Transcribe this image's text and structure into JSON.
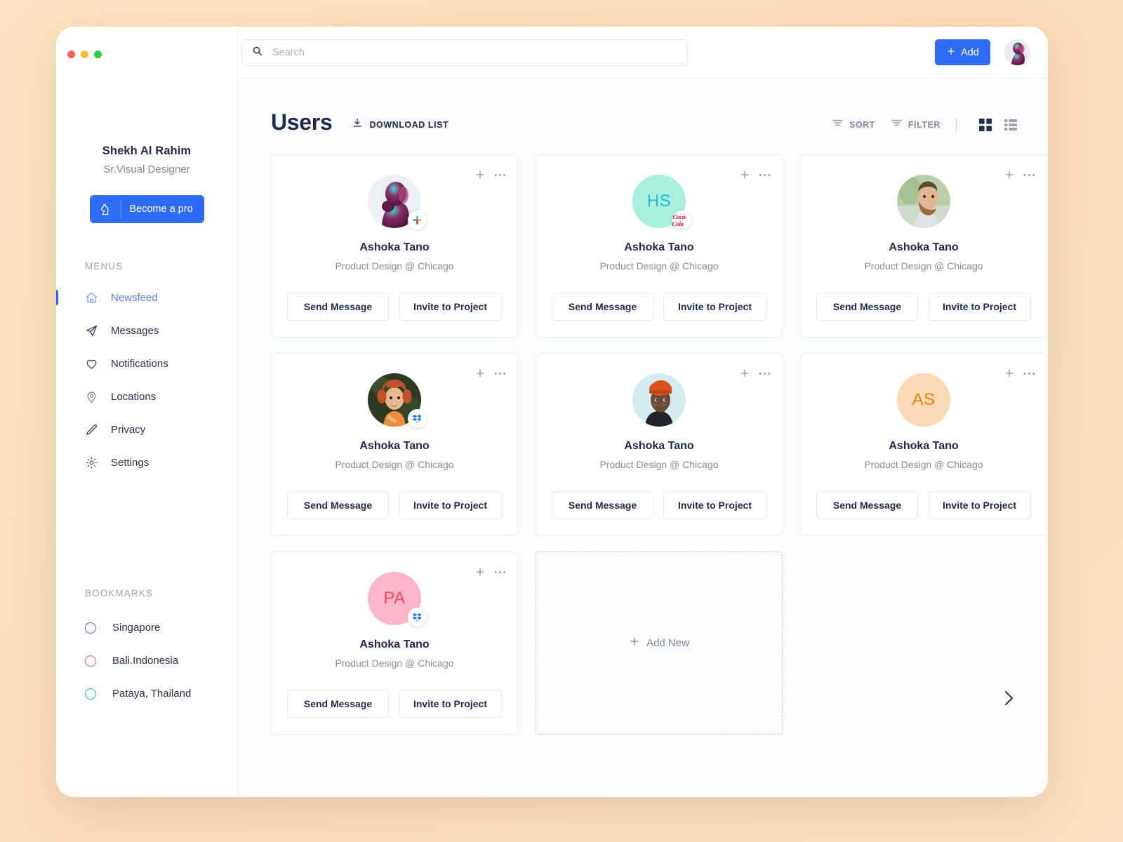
{
  "window": {
    "traffic_lights": [
      "close",
      "minimize",
      "maximize"
    ]
  },
  "sidebar": {
    "profile": {
      "name": "Shekh Al Rahim",
      "role": "Sr.Visual Designer",
      "pro_button_label": "Become a pro",
      "pro_button_icon": "chess-knight-icon",
      "pro_button_color": "#2f6cf6"
    },
    "menus_title": "MENUS",
    "items": [
      {
        "label": "Newsfeed",
        "icon": "home-icon",
        "active": true
      },
      {
        "label": "Messages",
        "icon": "paper-plane-icon",
        "active": false
      },
      {
        "label": "Notifications",
        "icon": "heart-icon",
        "active": false
      },
      {
        "label": "Locations",
        "icon": "map-pin-icon",
        "active": false
      },
      {
        "label": "Privacy",
        "icon": "pencil-icon",
        "active": false
      },
      {
        "label": "Settings",
        "icon": "gear-icon",
        "active": false
      }
    ],
    "bookmarks_title": "BOOKMARKS",
    "bookmarks": [
      {
        "label": "Singapore",
        "color": "#3b6ff0"
      },
      {
        "label": "Bali.Indonesia",
        "color": "#f2566a"
      },
      {
        "label": "Pataya, Thailand",
        "color": "#19c2b0"
      }
    ]
  },
  "topbar": {
    "search": {
      "placeholder": "Search",
      "value": "",
      "icon": "search-icon"
    },
    "add_label": "Add",
    "add_icon": "plus-icon",
    "avatar_icon": "user-avatar"
  },
  "page": {
    "title": "Users",
    "download_label": "DOWNLOAD LIST",
    "download_icon": "download-icon",
    "sort_label": "SORT",
    "sort_icon": "sort-icon",
    "filter_label": "FILTER",
    "filter_icon": "filter-icon",
    "grid_view_icon": "grid-view-icon",
    "list_view_icon": "list-view-icon",
    "active_view": "grid",
    "next_page_icon": "chevron-right-icon"
  },
  "card_buttons": {
    "send_message": "Send Message",
    "invite": "Invite to Project",
    "add_icon": "plus-icon",
    "more_icon": "more-horizontal-icon"
  },
  "users": [
    {
      "name": "Ashoka Tano",
      "subtitle": "Product Design @ Chicago",
      "avatar_type": "photo",
      "avatar_variant": "woman-teal-magenta",
      "badge": "slack-icon"
    },
    {
      "name": "Ashoka Tano",
      "subtitle": "Product Design @ Chicago",
      "avatar_type": "initials",
      "initials": "HS",
      "avatar_bg": "#a9f0dc",
      "avatar_fg": "#23bcd4",
      "badge": "coca-cola-icon"
    },
    {
      "name": "Ashoka Tano",
      "subtitle": "Product Design @ Chicago",
      "avatar_type": "photo",
      "avatar_variant": "bearded-man",
      "badge": "none"
    },
    {
      "name": "Ashoka Tano",
      "subtitle": "Product Design @ Chicago",
      "avatar_type": "photo",
      "avatar_variant": "red-curly-woman",
      "badge": "dropbox-icon"
    },
    {
      "name": "Ashoka Tano",
      "subtitle": "Product Design @ Chicago",
      "avatar_type": "photo",
      "avatar_variant": "man-orange-beanie",
      "badge": "none"
    },
    {
      "name": "Ashoka Tano",
      "subtitle": "Product Design @ Chicago",
      "avatar_type": "initials",
      "initials": "AS",
      "avatar_bg": "#fbd9b4",
      "avatar_fg": "#d98a12",
      "badge": "none"
    },
    {
      "name": "Ashoka Tano",
      "subtitle": "Product Design @ Chicago",
      "avatar_type": "initials",
      "initials": "PA",
      "avatar_bg": "#fcb6c8",
      "avatar_fg": "#f2485f",
      "badge": "dropbox-icon"
    }
  ],
  "add_new": {
    "label": "Add New",
    "icon": "plus-icon"
  }
}
